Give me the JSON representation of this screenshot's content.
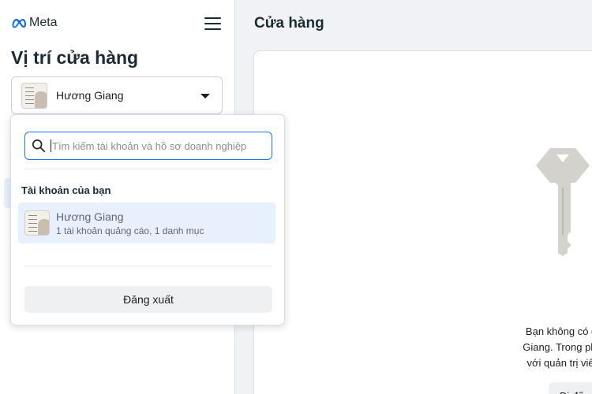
{
  "brand": {
    "name": "Meta"
  },
  "sidebar": {
    "title": "Vị trí cửa hàng"
  },
  "account_select": {
    "selected": "Hương Giang"
  },
  "dropdown": {
    "search_placeholder": "Tìm kiếm tài khoản và hồ sơ doanh nghiệp",
    "section_label": "Tài khoản của bạn",
    "accounts": [
      {
        "name": "Hương Giang",
        "details": "1 tài khoản quảng cáo, 1 danh mục"
      }
    ],
    "logout_label": "Đăng xuất"
  },
  "main": {
    "title": "Cửa hàng",
    "message_lines": [
      "Bạn không có quy",
      "Giang. Trong phần",
      "với quản trị viên c"
    ],
    "button_label": "Đi đến"
  },
  "icons": [
    "meta-logo-icon",
    "hamburger-menu-icon",
    "caret-down-icon",
    "search-icon",
    "key-icon"
  ],
  "colors": {
    "accent": "#1877f2",
    "selected_row": "#e7f0fc",
    "key": "#d4d2cc"
  }
}
